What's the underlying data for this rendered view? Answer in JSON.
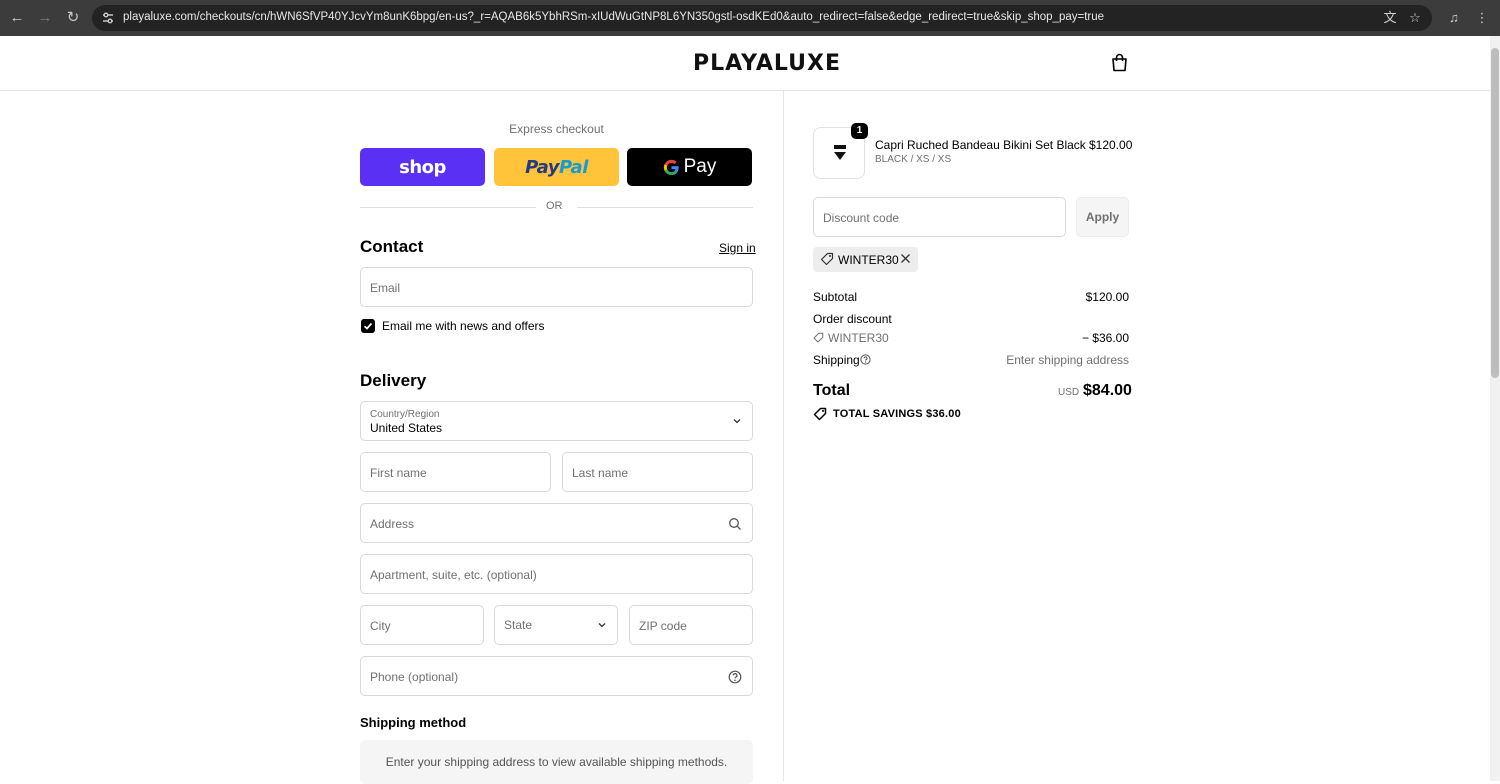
{
  "browser": {
    "url": "playaluxe.com/checkouts/cn/hWN6SfVP40YJcvYm8unK6bpg/en-us?_r=AQAB6k5YbhRSm-xIUdWuGtNP8L6YN350gstl-osdKEd0&auto_redirect=false&edge_redirect=true&skip_shop_pay=true"
  },
  "header": {
    "logo": "PLAYALUXE"
  },
  "express": {
    "title": "Express checkout",
    "shop_label": "shop",
    "paypal_a": "Pay",
    "paypal_b": "Pal",
    "gpay_label": "Pay",
    "or_label": "OR"
  },
  "contact": {
    "title": "Contact",
    "signin": "Sign in",
    "email_placeholder": "Email",
    "newsletter_label": "Email me with news and offers",
    "newsletter_checked": true
  },
  "delivery": {
    "title": "Delivery",
    "country_label": "Country/Region",
    "country_value": "United States",
    "first_name": "First name",
    "last_name": "Last name",
    "address": "Address",
    "apartment": "Apartment, suite, etc. (optional)",
    "city": "City",
    "state": "State",
    "zip": "ZIP code",
    "phone": "Phone (optional)"
  },
  "shipping_method": {
    "title": "Shipping method",
    "message": "Enter your shipping address to view available shipping methods."
  },
  "cart": {
    "item": {
      "quantity": "1",
      "name": "Capri Ruched Bandeau Bikini Set Black",
      "variant": "BLACK / XS / XS",
      "price": "$120.00"
    },
    "discount_placeholder": "Discount code",
    "apply_label": "Apply",
    "applied_code": "WINTER30"
  },
  "summary": {
    "subtotal_label": "Subtotal",
    "subtotal_value": "$120.00",
    "order_discount_label": "Order discount",
    "discount_code": "WINTER30",
    "discount_value": "− $36.00",
    "shipping_label": "Shipping",
    "shipping_value": "Enter shipping address",
    "total_label": "Total",
    "currency": "USD",
    "total_value": "$84.00",
    "savings": "TOTAL SAVINGS  $36.00"
  },
  "colors": {
    "shop": "#5a31f4",
    "paypal": "#ffc439",
    "gpay": "#000000"
  }
}
